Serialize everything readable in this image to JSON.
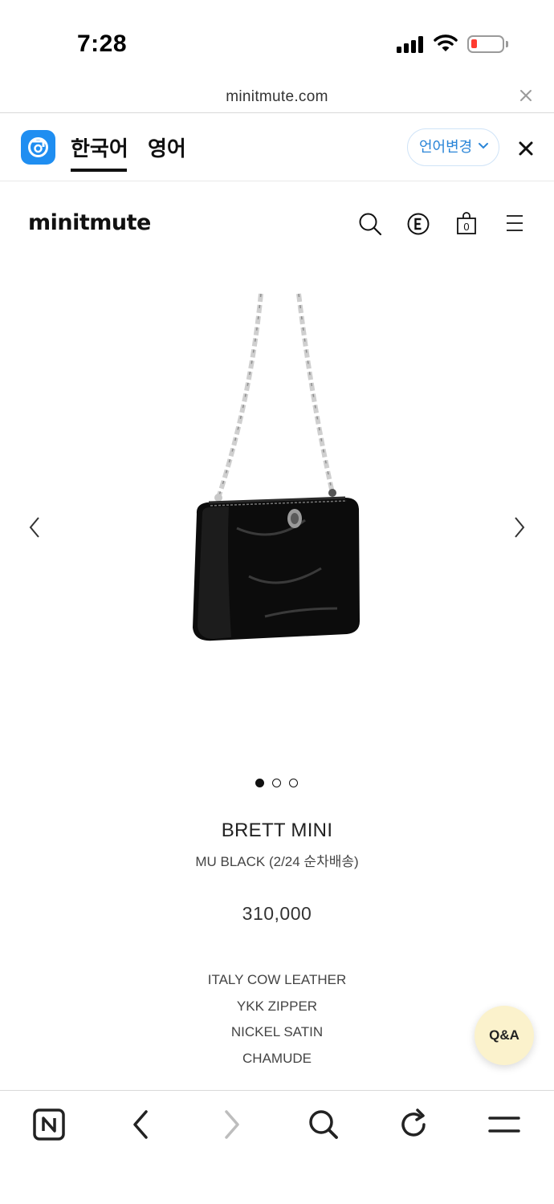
{
  "status_bar": {
    "time": "7:28"
  },
  "browser": {
    "url": "minitmute.com"
  },
  "translate_bar": {
    "tab_source": "한국어",
    "tab_target": "영어",
    "change_language_label": "언어변경"
  },
  "site": {
    "logo": "minitmute",
    "cart_count": "0"
  },
  "carousel": {
    "total_slides": 3,
    "active_index": 0
  },
  "product": {
    "name": "BRETT MINI",
    "variant": "MU BLACK (2/24 순차배송)",
    "price": "310,000",
    "specs": [
      "ITALY COW LEATHER",
      "YKK ZIPPER",
      "NICKEL SATIN",
      "CHAMUDE"
    ]
  },
  "floating": {
    "qa_label": "Q&A"
  },
  "colors": {
    "accent_blue": "#1f8ef1",
    "qa_bg": "#fbf2cc",
    "battery_low": "#ff3b30"
  },
  "icons": {
    "header": [
      "search-icon",
      "e-circle-icon",
      "shopping-bag-icon",
      "hamburger-menu-icon"
    ],
    "toolbar": [
      "naver-home-icon",
      "back-icon",
      "forward-icon",
      "search-icon",
      "refresh-icon",
      "menu-icon"
    ]
  }
}
